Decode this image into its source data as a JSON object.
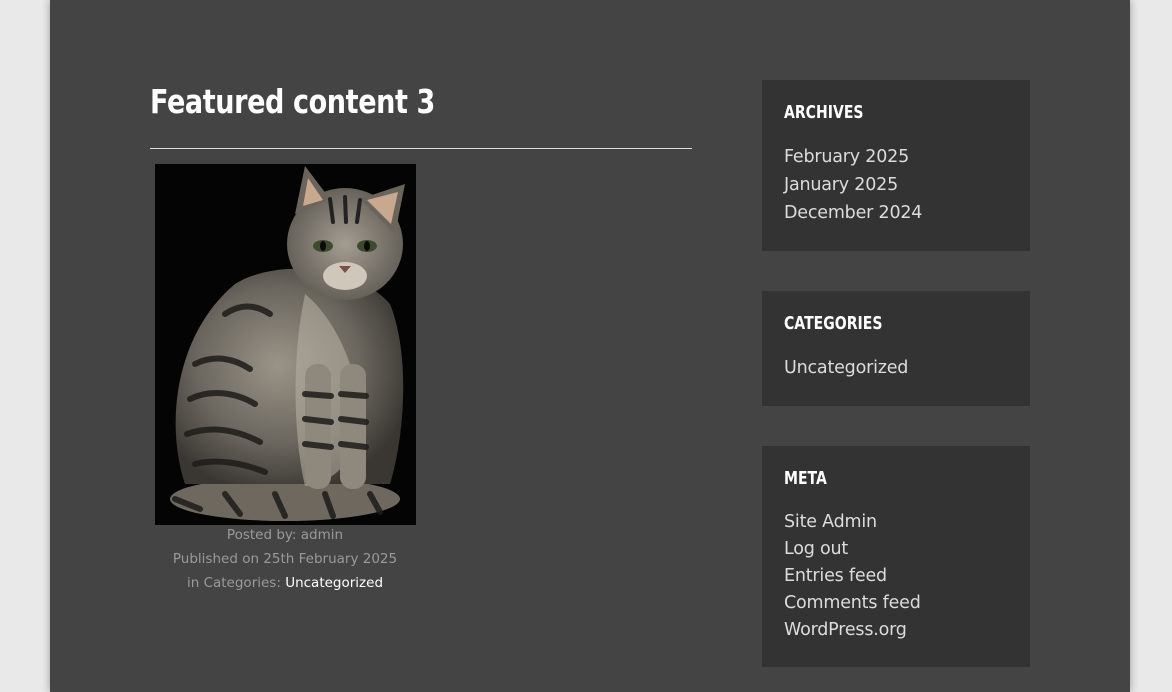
{
  "post": {
    "title": "Featured content 3",
    "image_alt": "Tabby cat sitting",
    "posted_by": "Posted by: admin",
    "published": "Published on 25th February 2025",
    "categories_prefix": "in Categories: ",
    "category_link": "Uncategorized"
  },
  "sidebar": {
    "archives": {
      "title": "ARCHIVES",
      "items": [
        "February 2025",
        "January 2025",
        "December 2024"
      ]
    },
    "categories": {
      "title": "CATEGORIES",
      "items": [
        "Uncategorized"
      ]
    },
    "meta": {
      "title": "META",
      "items": [
        "Site Admin",
        "Log out",
        "Entries feed",
        "Comments feed",
        "WordPress.org"
      ]
    }
  },
  "colors": {
    "page_background": "#444444",
    "outer_background": "#e9e9e9",
    "widget_background": "#333333",
    "title_text": "#ffffff",
    "link_text": "#dcdcdc",
    "meta_text": "#9a9a9a"
  }
}
